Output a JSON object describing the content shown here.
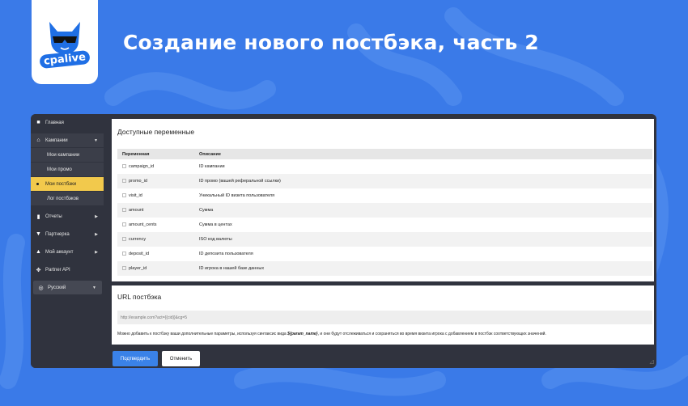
{
  "brand": {
    "logo_text": "cpalive"
  },
  "headline": "Создание нового постбэка, часть 2",
  "sidebar": {
    "items": [
      {
        "label": "Главная",
        "icon": "folder-icon"
      },
      {
        "label": "Кампании",
        "icon": "home-icon"
      },
      {
        "label": "Отчеты",
        "icon": "report-icon"
      },
      {
        "label": "Партнерка",
        "icon": "funnel-icon"
      },
      {
        "label": "Мой аккаунт",
        "icon": "user-icon"
      },
      {
        "label": "Partner API",
        "icon": "api-icon"
      },
      {
        "label": "Русский",
        "icon": "globe-icon"
      }
    ],
    "sub_items": [
      {
        "label": "Мои кампании"
      },
      {
        "label": "Мои промо"
      },
      {
        "label": "Мои постбэки"
      },
      {
        "label": "Лог постбэков"
      }
    ]
  },
  "variables_panel": {
    "title": "Доступные переменные",
    "col_variable": "Переменная",
    "col_description": "Описание",
    "rows": [
      {
        "var": "campaign_id",
        "desc": "ID кампании"
      },
      {
        "var": "promo_id",
        "desc": "ID промо (вашей реферальной ссылки)"
      },
      {
        "var": "visit_id",
        "desc": "Уникальный ID визита пользователя"
      },
      {
        "var": "amount",
        "desc": "Сумма"
      },
      {
        "var": "amount_cents",
        "desc": "Сумма в центах"
      },
      {
        "var": "currency",
        "desc": "ISO код валюты"
      },
      {
        "var": "deposit_id",
        "desc": "ID депозита пользователя"
      },
      {
        "var": "player_id",
        "desc": "ID игрока в нашей базе данных"
      }
    ]
  },
  "url_panel": {
    "title": "URL постбэка",
    "placeholder": "http://example.com?act={{cid}}&cg=5",
    "hint_before": "Можно добавить к постбэку ваши дополнительные параметры, используя синтаксис вида ",
    "hint_code": "${param_name}",
    "hint_after": ", и они будут отслеживаться и сохраняться во время визита игрока с добавлением в постбэк соответствующих значений."
  },
  "buttons": {
    "confirm": "Подтвердить",
    "cancel": "Отменить"
  },
  "colors": {
    "background": "#3a7ae8",
    "frame": "#30333e",
    "active": "#f2c94c",
    "primary_button": "#3a82e8"
  }
}
